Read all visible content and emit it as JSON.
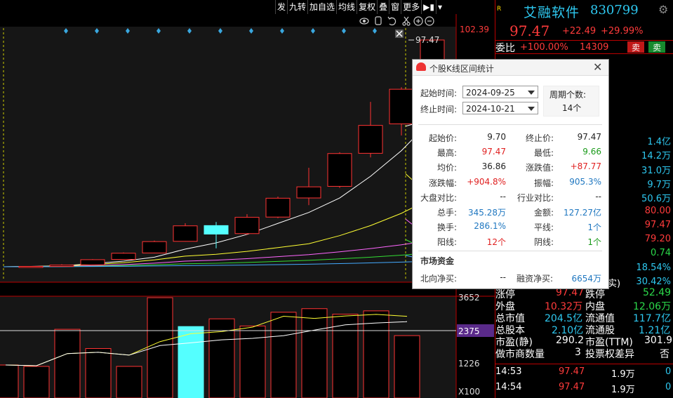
{
  "toolbar": {
    "items": [
      "发",
      "九转",
      "加自选",
      "均线",
      "复权",
      "叠",
      "窗",
      "更多"
    ]
  },
  "price_axis": {
    "top": "102.39",
    "last_price_tag": "97.47"
  },
  "volume_axis": {
    "labels": [
      "3652",
      "2375",
      "1226",
      "X100"
    ]
  },
  "stock": {
    "r_label": "R",
    "name": "艾融软件",
    "code": "830799",
    "price": "97.47",
    "change": "+22.49",
    "change_pct": "+29.99%",
    "weibi_label": "委比",
    "weibi_value": "+100.00%",
    "weicha": "14309",
    "sell_label": "卖",
    "buy_label": "卖"
  },
  "right_list": [
    {
      "value": "1.4亿",
      "color": "#2ec8f0"
    },
    {
      "value": "14.2万",
      "color": "#2ec8f0"
    },
    {
      "value": "31.0万",
      "color": "#2ec8f0"
    },
    {
      "value": "9.7万",
      "color": "#2ec8f0"
    },
    {
      "value": "50.6万",
      "color": "#2ec8f0"
    },
    {
      "value": "80.00",
      "color": "#ff3b3b"
    },
    {
      "value": "97.47",
      "color": "#ff3b3b"
    },
    {
      "value": "79.20",
      "color": "#ff3b3b"
    },
    {
      "value": "0.74",
      "color": "#2bd94a"
    },
    {
      "value": "18.54%",
      "color": "#2ec8f0"
    },
    {
      "value": "30.42%",
      "color": "#2ec8f0"
    }
  ],
  "stats": {
    "zhangting_label": "涨停",
    "zhangting_value": "97.47",
    "dieting_label": "跌停",
    "dieting_value": "52.49",
    "waipan_label": "外盘",
    "waipan_value": "10.32万",
    "neipan_label": "内盘",
    "neipan_value": "12.06万",
    "zongshizhi_label": "总市值",
    "zongshizhi_value": "204.5亿",
    "liutongzhi_label": "流通值",
    "liutongzhi_value": "117.7亿",
    "zongguben_label": "总股本",
    "zongguben_value": "2.10亿",
    "liutonggu_label": "流通股",
    "liutonggu_value": "1.21亿",
    "shiying_jing_label": "市盈(静)",
    "shiying_jing_value": "290.2",
    "shiying_ttm_label": "市盈(TTM)",
    "shiying_ttm_value": "301.9",
    "zuoshi_label": "做市商数量",
    "zuoshi_value": "3",
    "toupiao_label": "投票权差异",
    "toupiao_value": "否",
    "hidden_fragment": "实)"
  },
  "ticks": [
    {
      "time": "14:53",
      "price": "97.47",
      "vol": "1.9万",
      "flag": "0"
    },
    {
      "time": "14:54",
      "price": "97.47",
      "vol": "1.9万",
      "flag": "0"
    }
  ],
  "dialog": {
    "title": "个股K线区间统计",
    "start_label": "起始时间:",
    "start_value": "2024-09-25",
    "end_label": "终止时间:",
    "end_value": "2024-10-21",
    "period_label": "周期个数:",
    "period_value": "14个",
    "rows": [
      {
        "l1": "起始价:",
        "v1": "9.70",
        "c1": "#222",
        "l2": "终止价:",
        "v2": "97.47",
        "c2": "#222"
      },
      {
        "l1": "最高:",
        "v1": "97.47",
        "c1": "#e02020",
        "l2": "最低:",
        "v2": "9.66",
        "c2": "#1a9a1a"
      },
      {
        "l1": "均价:",
        "v1": "36.86",
        "c1": "#222",
        "l2": "涨跌值:",
        "v2": "+87.77",
        "c2": "#e02020"
      },
      {
        "l1": "涨跌幅:",
        "v1": "+904.8%",
        "c1": "#e02020",
        "l2": "振幅:",
        "v2": "905.3%",
        "c2": "#1f77c0"
      },
      {
        "l1": "大盘对比:",
        "v1": "--",
        "c1": "#222",
        "l2": "行业对比:",
        "v2": "--",
        "c2": "#222"
      },
      {
        "l1": "总手:",
        "v1": "345.28万",
        "c1": "#1f77c0",
        "l2": "金额:",
        "v2": "127.27亿",
        "c2": "#1f77c0"
      },
      {
        "l1": "换手:",
        "v1": "286.1%",
        "c1": "#1f77c0",
        "l2": "平线:",
        "v2": "1个",
        "c2": "#1f77c0"
      },
      {
        "l1": "阳线:",
        "v1": "12个",
        "c1": "#e02020",
        "l2": "阴线:",
        "v2": "1个",
        "c2": "#1a9a1a"
      }
    ],
    "capital_title": "市场资金",
    "north_label": "北向净买:",
    "north_value": "--",
    "margin_label": "融资净买:",
    "margin_value": "6654万"
  },
  "candles": [
    {
      "o": 9.7,
      "c": 9.8,
      "h": 9.9,
      "l": 9.66
    },
    {
      "o": 9.8,
      "c": 10.3,
      "h": 10.6,
      "l": 9.7
    },
    {
      "o": 10.4,
      "c": 12.4,
      "h": 12.6,
      "l": 10.3
    },
    {
      "o": 12.5,
      "c": 14.9,
      "h": 15.2,
      "l": 12.4
    },
    {
      "o": 15.0,
      "c": 19.4,
      "h": 19.8,
      "l": 14.9
    },
    {
      "o": 19.5,
      "c": 25.5,
      "h": 26.5,
      "l": 19.4
    },
    {
      "o": 25.6,
      "c": 22.3,
      "h": 27.0,
      "l": 16.8
    },
    {
      "o": 22.5,
      "c": 28.8,
      "h": 30.0,
      "l": 22.0
    },
    {
      "o": 28.9,
      "c": 36.2,
      "h": 36.8,
      "l": 28.5
    },
    {
      "o": 36.3,
      "c": 40.6,
      "h": 48.0,
      "l": 33.5
    },
    {
      "o": 40.8,
      "c": 53.5,
      "h": 54.0,
      "l": 40.2
    },
    {
      "o": 53.6,
      "c": 64.4,
      "h": 73.5,
      "l": 52.0
    },
    {
      "o": 65.0,
      "c": 78.4,
      "h": 79.2,
      "l": 60.5
    },
    {
      "o": 80.0,
      "c": 97.47,
      "h": 97.47,
      "l": 79.2
    }
  ],
  "volumes": [
    1200,
    1150,
    2500,
    1800,
    1150,
    3650,
    2600,
    2880,
    2620,
    3120,
    3250,
    3050,
    3170,
    2270
  ],
  "volume_up": [
    true,
    true,
    true,
    true,
    true,
    true,
    false,
    true,
    true,
    true,
    true,
    true,
    true,
    true
  ]
}
